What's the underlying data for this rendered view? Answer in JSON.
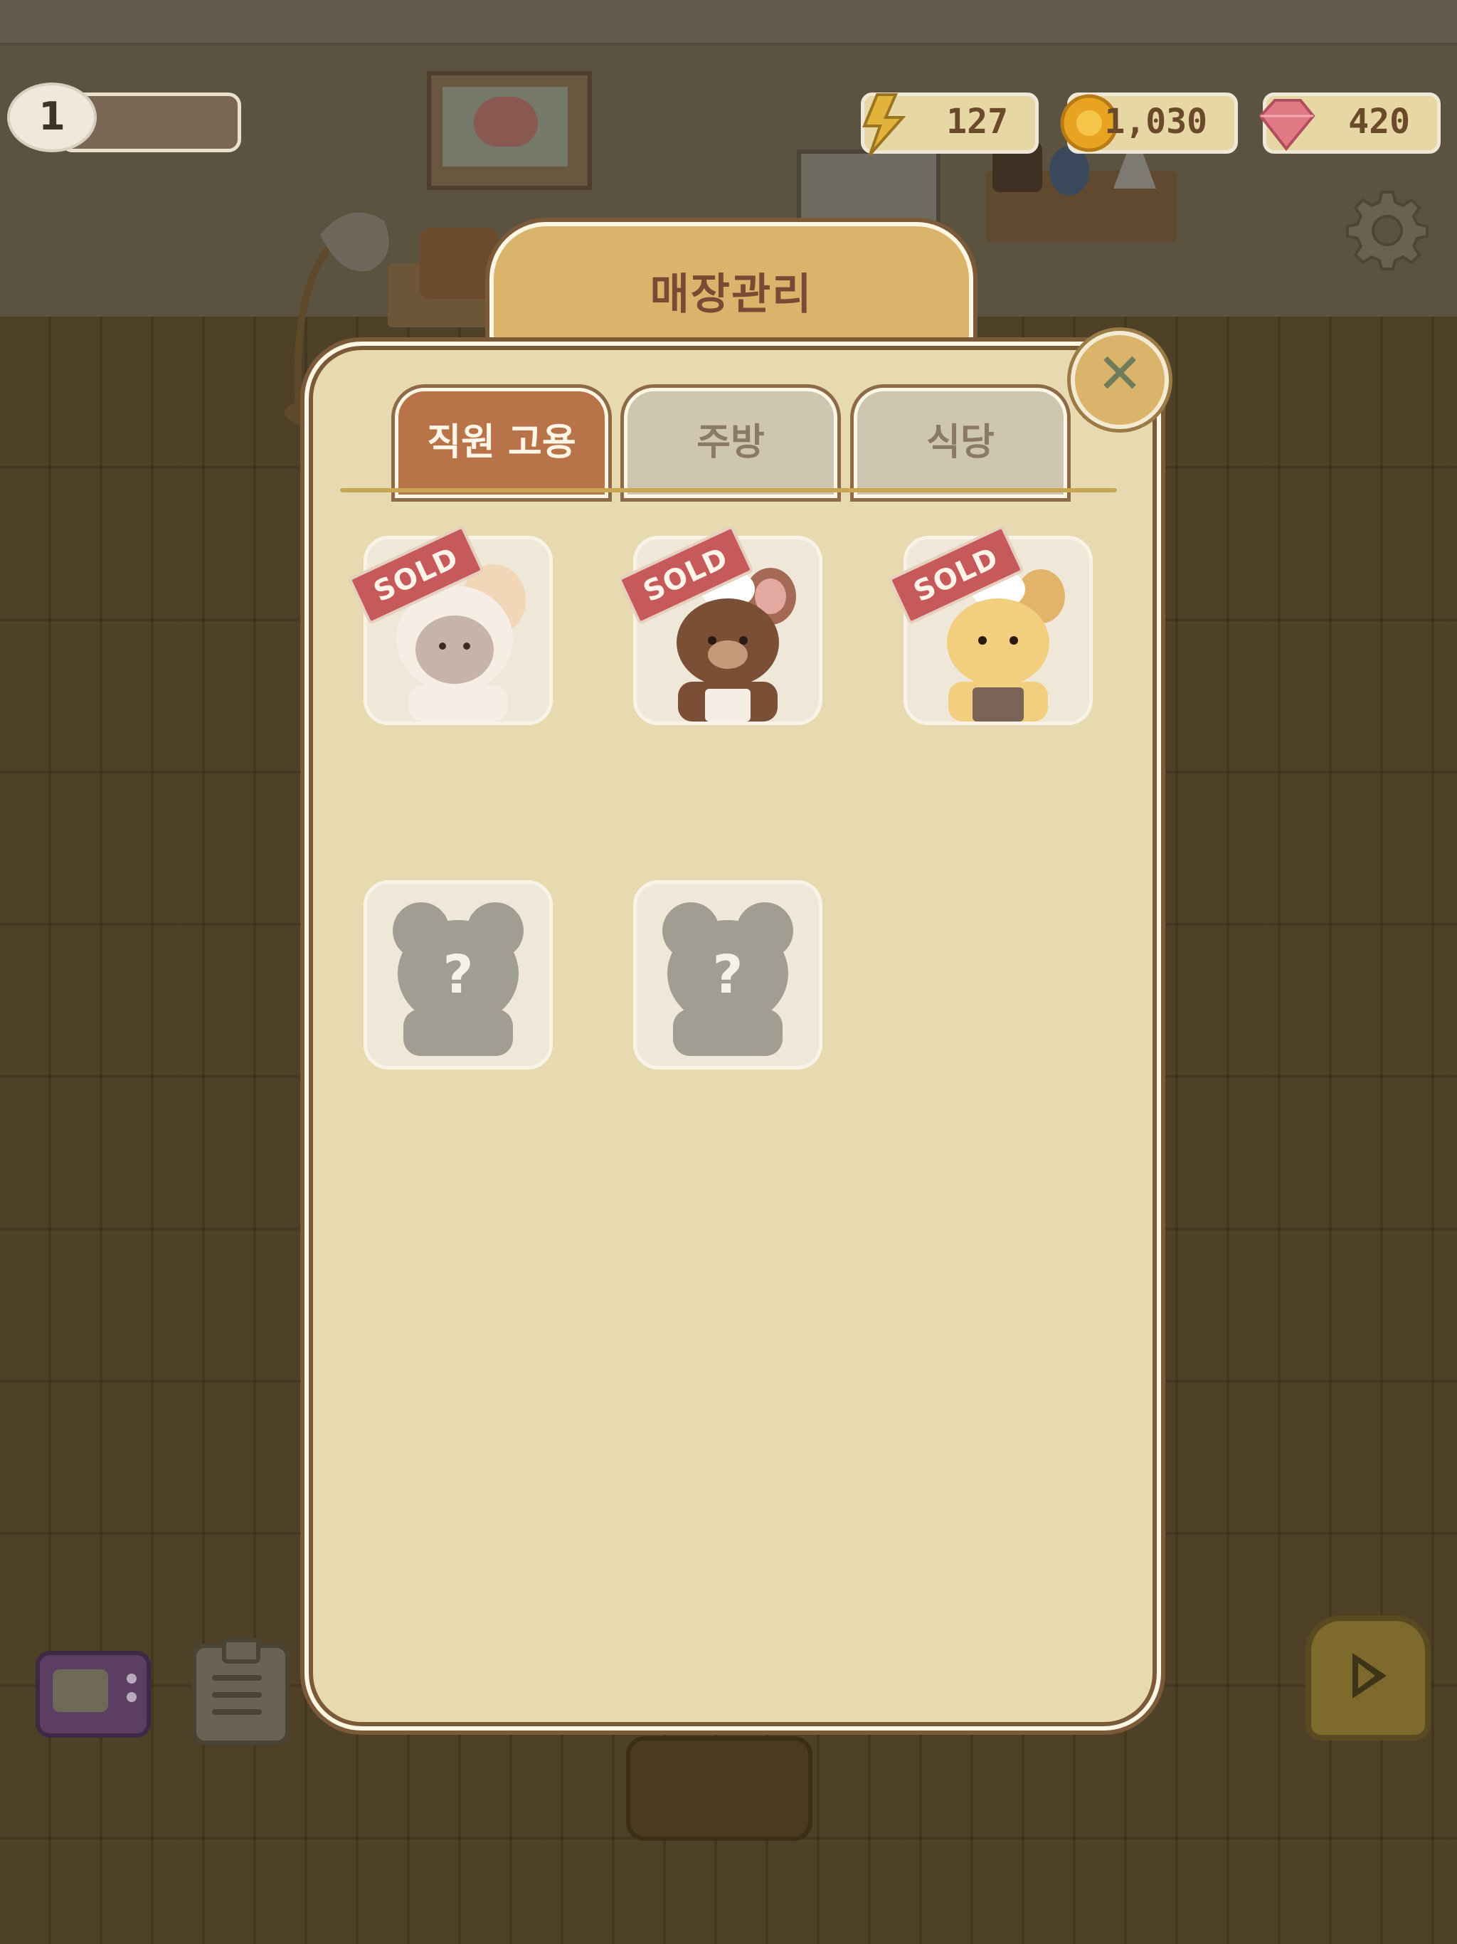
{
  "hud": {
    "level": "1",
    "energy": "127",
    "coins": "1,030",
    "gems": "420"
  },
  "modal": {
    "title": "매장관리",
    "tabs": [
      {
        "label": "직원 고용",
        "active": true
      },
      {
        "label": "주방",
        "active": false
      },
      {
        "label": "식당",
        "active": false
      }
    ],
    "staff": [
      {
        "name": "bunny-staff",
        "sold_label": "SOLD",
        "status": "sold"
      },
      {
        "name": "bear-staff",
        "sold_label": "SOLD",
        "status": "sold"
      },
      {
        "name": "cat-staff",
        "sold_label": "SOLD",
        "status": "sold"
      },
      {
        "name": "locked-staff-1",
        "mystery_label": "?",
        "status": "locked"
      },
      {
        "name": "locked-staff-2",
        "mystery_label": "?",
        "status": "locked"
      }
    ]
  },
  "colors": {
    "panel": "#e7d9b0",
    "title_tab": "#d9b46a",
    "active_tab": "#b87448",
    "inactive_tab": "#cfc6b2",
    "sold_badge": "#c65a5a"
  },
  "icons": [
    "lightning-icon",
    "coin-icon",
    "gem-icon",
    "gear-icon",
    "close-icon",
    "tv-icon",
    "clipboard-icon",
    "play-icon"
  ]
}
